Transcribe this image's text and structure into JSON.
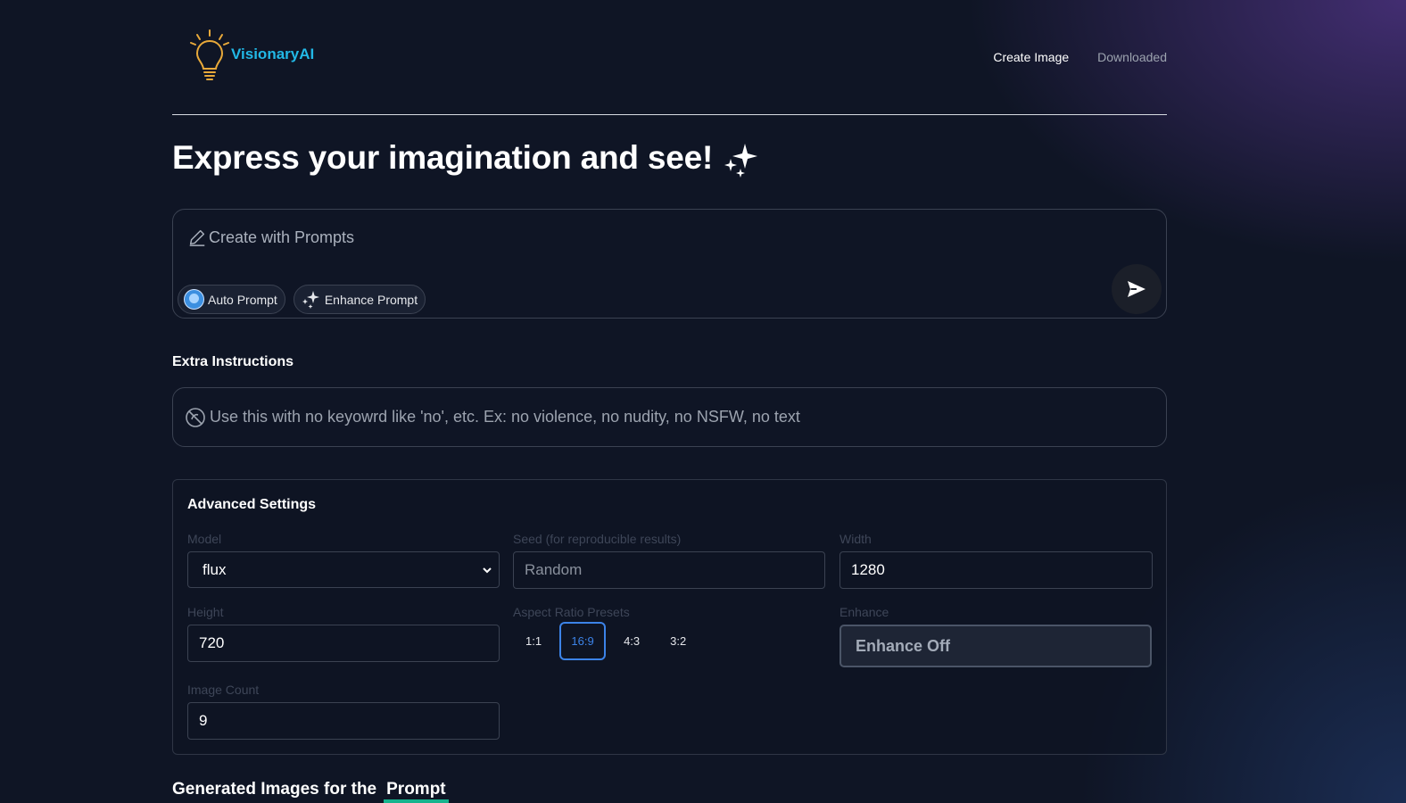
{
  "header": {
    "logo_text": "VisionaryAI",
    "nav": [
      {
        "label": "Create Image",
        "active": true
      },
      {
        "label": "Downloaded",
        "active": false
      }
    ]
  },
  "hero": {
    "title": "Express your imagination and see!"
  },
  "prompt": {
    "placeholder": "Create with Prompts",
    "value": "",
    "auto_prompt_label": "Auto Prompt",
    "enhance_prompt_label": "Enhance Prompt"
  },
  "extra": {
    "label": "Extra Instructions",
    "placeholder": "Use this with no keyowrd like 'no', etc. Ex: no violence, no nudity, no NSFW, no text"
  },
  "advanced": {
    "title": "Advanced Settings",
    "model_label": "Model",
    "model_value": "flux",
    "seed_label": "Seed (for reproducible results)",
    "seed_placeholder": "Random",
    "width_label": "Width",
    "width_value": "1280",
    "height_label": "Height",
    "height_value": "720",
    "aspect_label": "Aspect Ratio Presets",
    "aspect_presets": [
      "1:1",
      "16:9",
      "4:3",
      "3:2"
    ],
    "aspect_selected": "16:9",
    "enhance_label": "Enhance",
    "enhance_value": "Enhance Off",
    "image_count_label": "Image Count",
    "image_count_value": "9"
  },
  "generated": {
    "title_prefix": "Generated Images for the",
    "title_word": "Prompt"
  },
  "colors": {
    "accent_logo": "#22b8e6",
    "accent_selected": "#3c83e8",
    "underline": "#16b38d",
    "background": "#0f1525"
  },
  "icons": [
    "lightbulb-icon",
    "sparkle-icon",
    "pencil-icon",
    "send-icon",
    "no-icon",
    "chevron-down-icon"
  ]
}
